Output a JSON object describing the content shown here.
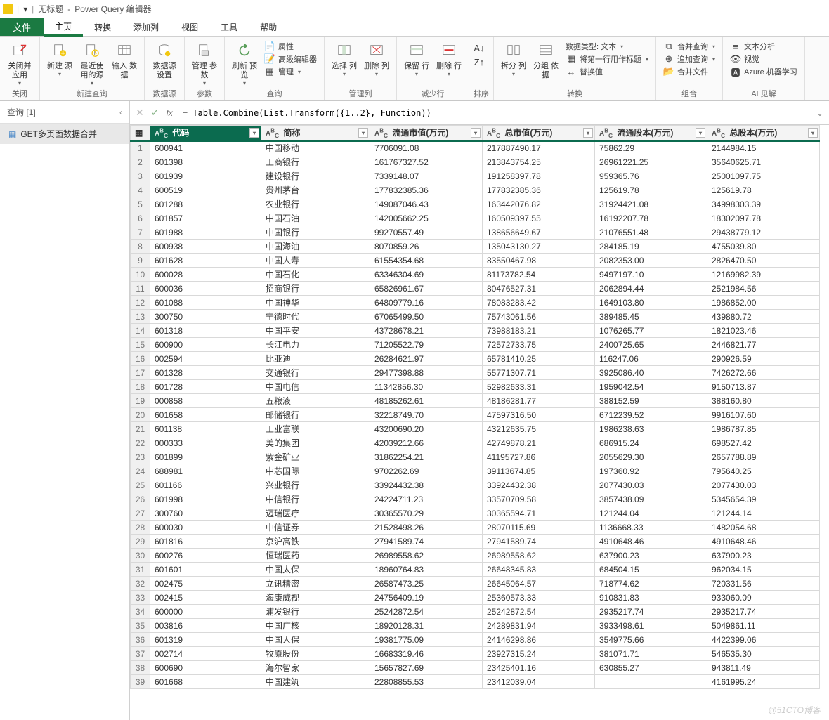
{
  "titlebar": {
    "doc": "无标题",
    "app": "Power Query 编辑器",
    "sep": "|",
    "caret": "▾"
  },
  "tabs": {
    "file": "文件",
    "home": "主页",
    "transform": "转换",
    "addcol": "添加列",
    "view": "视图",
    "tools": "工具",
    "help": "帮助"
  },
  "ribbon": {
    "close": {
      "btn": "关闭并\n应用",
      "group": "关闭"
    },
    "newq": {
      "new": "新建\n源",
      "recent": "最近使\n用的源",
      "enter": "输入\n数据",
      "group": "新建查询"
    },
    "ds": {
      "settings": "数据源\n设置",
      "group": "数据源"
    },
    "params": {
      "manage": "管理\n参数",
      "group": "参数"
    },
    "query": {
      "refresh": "刷新\n预览",
      "props": "属性",
      "adv": "高级编辑器",
      "manage": "管理",
      "group": "查询"
    },
    "cols": {
      "choose": "选择\n列",
      "remove": "删除\n列",
      "group": "管理列"
    },
    "rows": {
      "keep": "保留\n行",
      "remove": "删除\n行",
      "group": "减少行"
    },
    "sortg": "排序",
    "split": {
      "split": "拆分\n列",
      "groupby": "分组\n依据",
      "datatype": "数据类型: 文本",
      "firstrow": "将第一行用作标题",
      "replace": "替换值",
      "group": "转换"
    },
    "combine": {
      "merge": "合并查询",
      "append": "追加查询",
      "combinef": "合并文件",
      "group": "组合"
    },
    "ai": {
      "text": "文本分析",
      "vision": "视觉",
      "ml": "Azure 机器学习",
      "group": "AI 见解"
    }
  },
  "queries": {
    "header": "查询",
    "count": "[1]",
    "item": "GET多页面数据合并"
  },
  "formula": {
    "text": "= Table.Combine(List.Transform({1..2}, Function))"
  },
  "columns": [
    "代码",
    "简称",
    "流通市值(万元)",
    "总市值(万元)",
    "流通股本(万元)",
    "总股本(万元)"
  ],
  "rows_data": [
    [
      "600941",
      "中国移动",
      "7706091.08",
      "217887490.17",
      "75862.29",
      "2144984.15"
    ],
    [
      "601398",
      "工商银行",
      "161767327.52",
      "213843754.25",
      "26961221.25",
      "35640625.71"
    ],
    [
      "601939",
      "建设银行",
      "7339148.07",
      "191258397.78",
      "959365.76",
      "25001097.75"
    ],
    [
      "600519",
      "贵州茅台",
      "177832385.36",
      "177832385.36",
      "125619.78",
      "125619.78"
    ],
    [
      "601288",
      "农业银行",
      "149087046.43",
      "163442076.82",
      "31924421.08",
      "34998303.39"
    ],
    [
      "601857",
      "中国石油",
      "142005662.25",
      "160509397.55",
      "16192207.78",
      "18302097.78"
    ],
    [
      "601988",
      "中国银行",
      "99270557.49",
      "138656649.67",
      "21076551.48",
      "29438779.12"
    ],
    [
      "600938",
      "中国海油",
      "8070859.26",
      "135043130.27",
      "284185.19",
      "4755039.80"
    ],
    [
      "601628",
      "中国人寿",
      "61554354.68",
      "83550467.98",
      "2082353.00",
      "2826470.50"
    ],
    [
      "600028",
      "中国石化",
      "63346304.69",
      "81173782.54",
      "9497197.10",
      "12169982.39"
    ],
    [
      "600036",
      "招商银行",
      "65826961.67",
      "80476527.31",
      "2062894.44",
      "2521984.56"
    ],
    [
      "601088",
      "中国神华",
      "64809779.16",
      "78083283.42",
      "1649103.80",
      "1986852.00"
    ],
    [
      "300750",
      "宁德时代",
      "67065499.50",
      "75743061.56",
      "389485.45",
      "439880.72"
    ],
    [
      "601318",
      "中国平安",
      "43728678.21",
      "73988183.21",
      "1076265.77",
      "1821023.46"
    ],
    [
      "600900",
      "长江电力",
      "71205522.79",
      "72572733.75",
      "2400725.65",
      "2446821.77"
    ],
    [
      "002594",
      "比亚迪",
      "26284621.97",
      "65781410.25",
      "116247.06",
      "290926.59"
    ],
    [
      "601328",
      "交通银行",
      "29477398.88",
      "55771307.71",
      "3925086.40",
      "7426272.66"
    ],
    [
      "601728",
      "中国电信",
      "11342856.30",
      "52982633.31",
      "1959042.54",
      "9150713.87"
    ],
    [
      "000858",
      "五粮液",
      "48185262.61",
      "48186281.77",
      "388152.59",
      "388160.80"
    ],
    [
      "601658",
      "邮储银行",
      "32218749.70",
      "47597316.50",
      "6712239.52",
      "9916107.60"
    ],
    [
      "601138",
      "工业富联",
      "43200690.20",
      "43212635.75",
      "1986238.63",
      "1986787.85"
    ],
    [
      "000333",
      "美的集团",
      "42039212.66",
      "42749878.21",
      "686915.24",
      "698527.42"
    ],
    [
      "601899",
      "紫金矿业",
      "31862254.21",
      "41195727.86",
      "2055629.30",
      "2657788.89"
    ],
    [
      "688981",
      "中芯国际",
      "9702262.69",
      "39113674.85",
      "197360.92",
      "795640.25"
    ],
    [
      "601166",
      "兴业银行",
      "33924432.38",
      "33924432.38",
      "2077430.03",
      "2077430.03"
    ],
    [
      "601998",
      "中信银行",
      "24224711.23",
      "33570709.58",
      "3857438.09",
      "5345654.39"
    ],
    [
      "300760",
      "迈瑞医疗",
      "30365570.29",
      "30365594.71",
      "121244.04",
      "121244.14"
    ],
    [
      "600030",
      "中信证券",
      "21528498.26",
      "28070115.69",
      "1136668.33",
      "1482054.68"
    ],
    [
      "601816",
      "京沪高铁",
      "27941589.74",
      "27941589.74",
      "4910648.46",
      "4910648.46"
    ],
    [
      "600276",
      "恒瑞医药",
      "26989558.62",
      "26989558.62",
      "637900.23",
      "637900.23"
    ],
    [
      "601601",
      "中国太保",
      "18960764.83",
      "26648345.83",
      "684504.15",
      "962034.15"
    ],
    [
      "002475",
      "立讯精密",
      "26587473.25",
      "26645064.57",
      "718774.62",
      "720331.56"
    ],
    [
      "002415",
      "海康威视",
      "24756409.19",
      "25360573.33",
      "910831.83",
      "933060.09"
    ],
    [
      "600000",
      "浦发银行",
      "25242872.54",
      "25242872.54",
      "2935217.74",
      "2935217.74"
    ],
    [
      "003816",
      "中国广核",
      "18920128.31",
      "24289831.94",
      "3933498.61",
      "5049861.11"
    ],
    [
      "601319",
      "中国人保",
      "19381775.09",
      "24146298.86",
      "3549775.66",
      "4422399.06"
    ],
    [
      "002714",
      "牧原股份",
      "16683319.46",
      "23927315.24",
      "381071.71",
      "546535.30"
    ],
    [
      "600690",
      "海尔智家",
      "15657827.69",
      "23425401.16",
      "630855.27",
      "943811.49"
    ],
    [
      "601668",
      "中国建筑",
      "22808855.53",
      "23412039.04",
      "",
      "4161995.24"
    ]
  ],
  "watermark": "@51CTO博客"
}
